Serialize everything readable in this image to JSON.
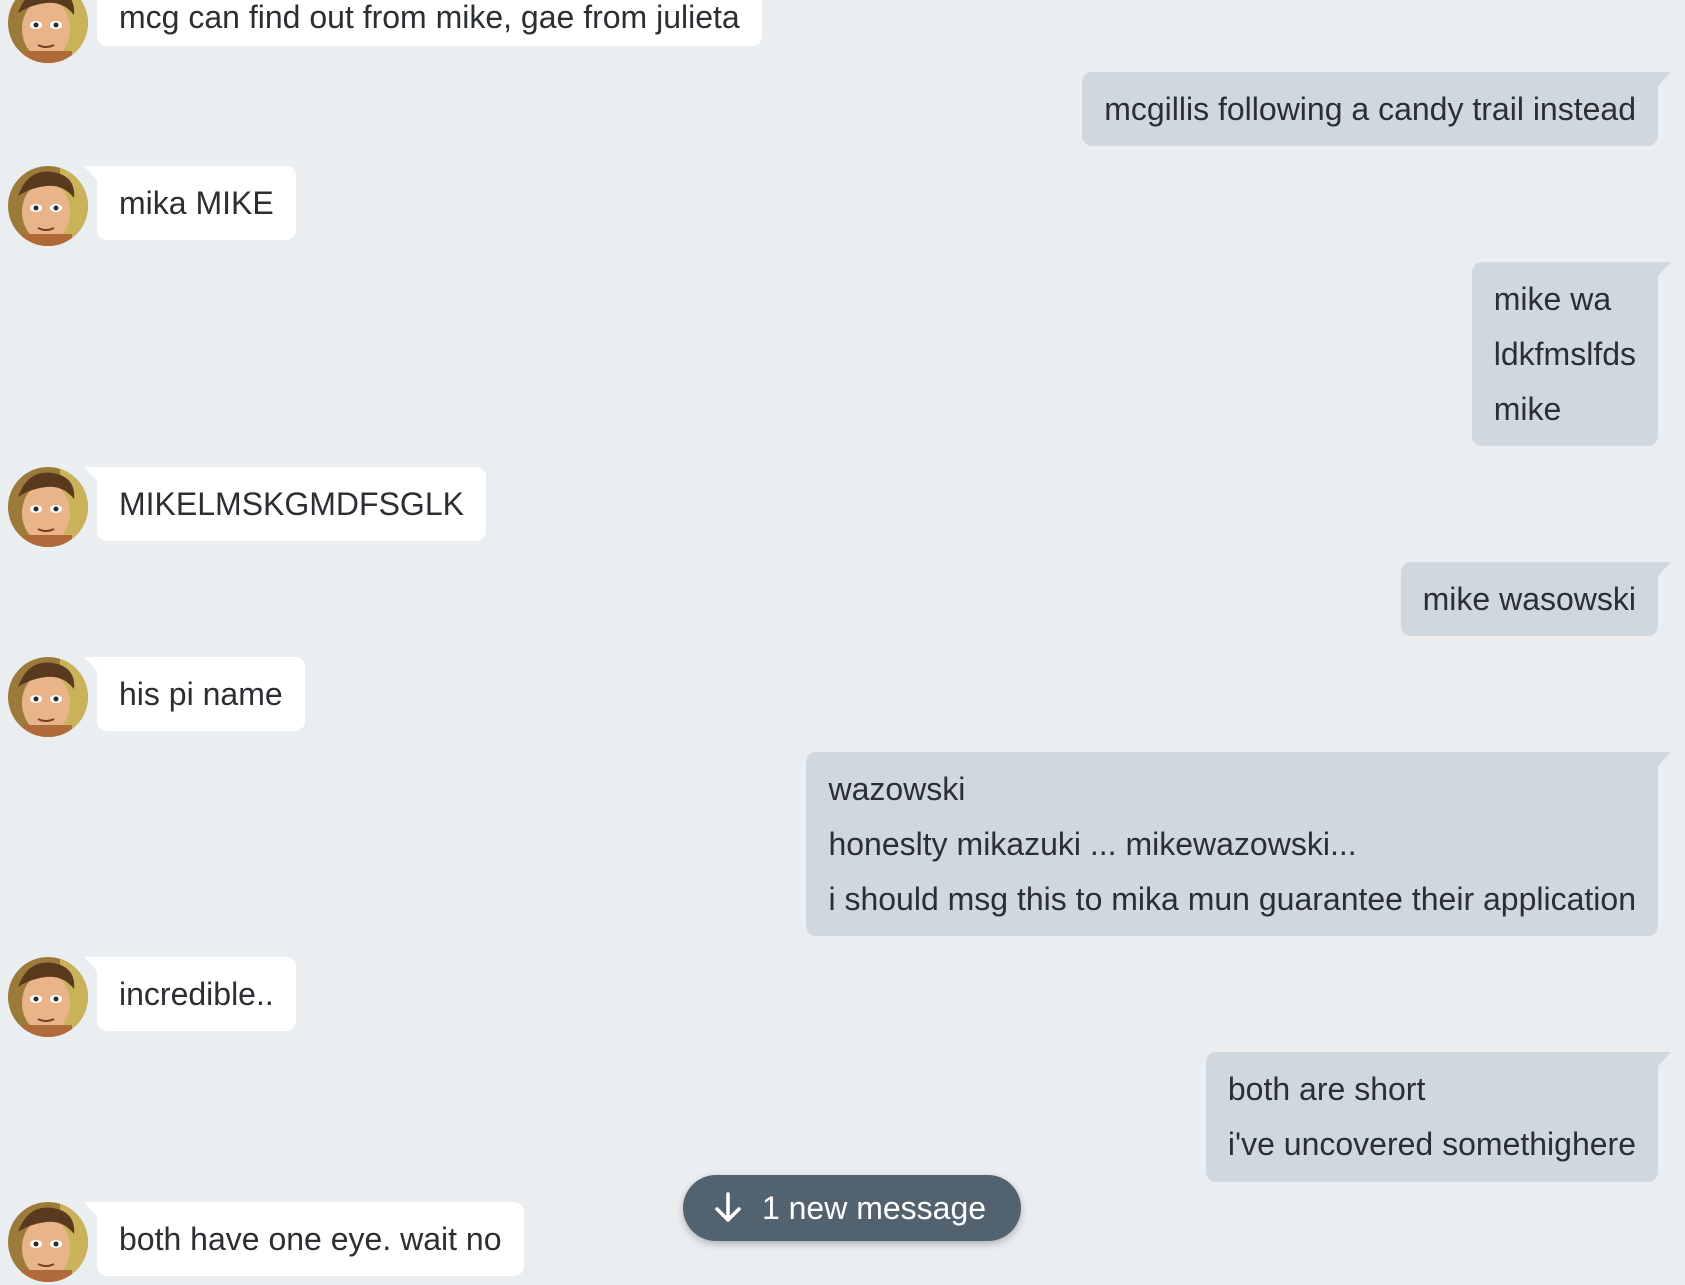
{
  "colors": {
    "background": "#ebeef1",
    "incoming_bubble": "#ffffff",
    "outgoing_bubble": "#d0d8df",
    "new_message_pill": "#52636f",
    "text": "#2b2f33"
  },
  "messages": [
    {
      "direction": "in",
      "lines": [
        "mcg can find out from mike, gae from julieta"
      ]
    },
    {
      "direction": "out",
      "lines": [
        "mcgillis following a candy trail instead"
      ]
    },
    {
      "direction": "in",
      "lines": [
        "mika MIKE"
      ]
    },
    {
      "direction": "out",
      "lines": [
        "mike wa",
        "ldkfmslfds",
        "mike"
      ]
    },
    {
      "direction": "in",
      "lines": [
        "MIKELMSKGMDFSGLK"
      ]
    },
    {
      "direction": "out",
      "lines": [
        "mike wasowski"
      ]
    },
    {
      "direction": "in",
      "lines": [
        "his pi name"
      ]
    },
    {
      "direction": "out",
      "lines": [
        "wazowski",
        "honeslty mikazuki ... mikewazowski...",
        "i should msg this to mika mun guarantee their application"
      ]
    },
    {
      "direction": "in",
      "lines": [
        "incredible.."
      ]
    },
    {
      "direction": "out",
      "lines": [
        "both are short",
        "i've uncovered somethighere"
      ]
    },
    {
      "direction": "in",
      "lines": [
        "both have one eye. wait no"
      ]
    }
  ],
  "new_message_button": {
    "label": "1 new message",
    "icon": "arrow-down-icon"
  },
  "avatar": {
    "icon": "user-avatar-icon"
  }
}
